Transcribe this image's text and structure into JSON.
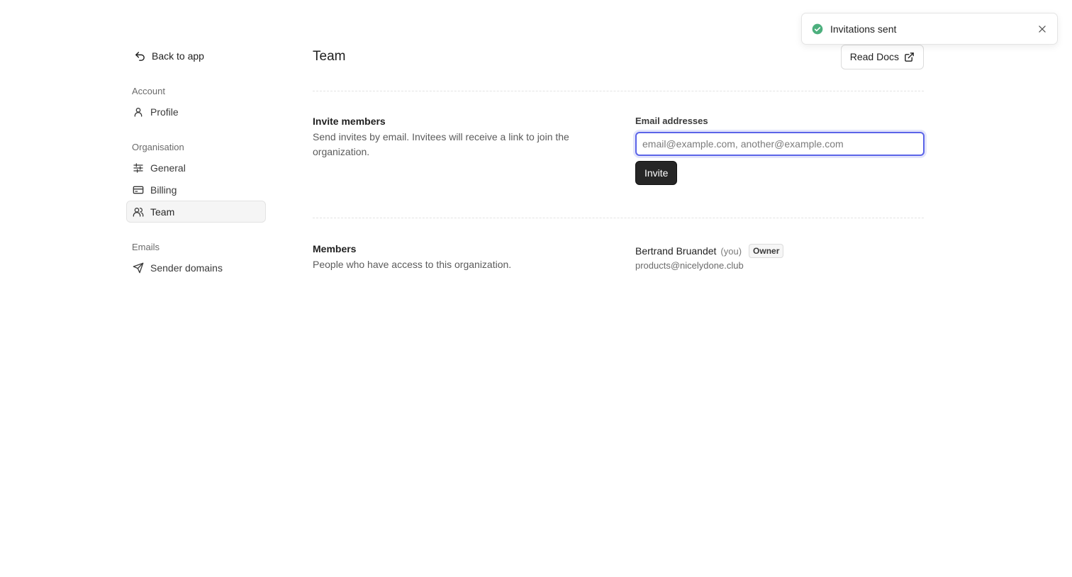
{
  "sidebar": {
    "back_label": "Back to app",
    "sections": [
      {
        "label": "Account",
        "items": [
          {
            "label": "Profile",
            "icon": "user-icon"
          }
        ]
      },
      {
        "label": "Organisation",
        "items": [
          {
            "label": "General",
            "icon": "sliders-icon"
          },
          {
            "label": "Billing",
            "icon": "credit-card-icon"
          },
          {
            "label": "Team",
            "icon": "users-icon",
            "active": true
          }
        ]
      },
      {
        "label": "Emails",
        "items": [
          {
            "label": "Sender domains",
            "icon": "send-icon"
          }
        ]
      }
    ]
  },
  "header": {
    "title": "Team",
    "read_docs_label": "Read Docs"
  },
  "invite": {
    "title": "Invite members",
    "description": "Send invites by email. Invitees will receive a link to join the organization.",
    "field_label": "Email addresses",
    "placeholder": "email@example.com, another@example.com",
    "value": "",
    "button_label": "Invite"
  },
  "members": {
    "title": "Members",
    "description": "People who have access to this organization.",
    "list": [
      {
        "name": "Bertrand Bruandet",
        "you_label": "(you)",
        "role": "Owner",
        "email": "products@nicelydone.club"
      }
    ]
  },
  "toast": {
    "message": "Invitations sent",
    "status_color": "#4caf7d"
  },
  "colors": {
    "accent": "#5b64e8",
    "primary_button": "#262626"
  }
}
